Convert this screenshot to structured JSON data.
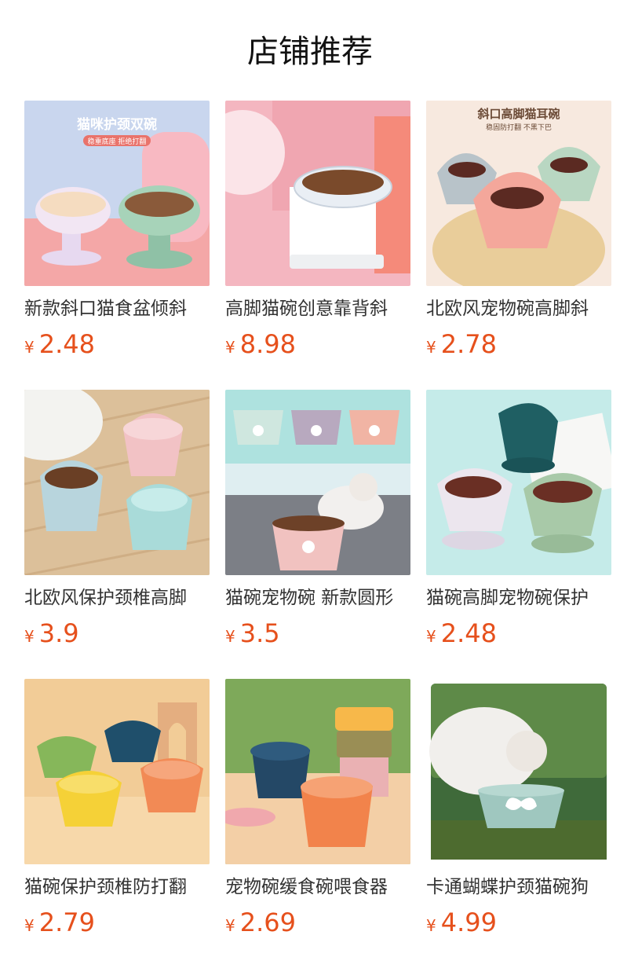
{
  "section": {
    "title": "店铺推荐"
  },
  "products": [
    {
      "name": "新款斜口猫食盆倾斜",
      "currency": "¥",
      "price": "2.48",
      "banner_title": "猫咪护颈双碗",
      "banner_sub": "稳重底座 拒绝打翻"
    },
    {
      "name": "高脚猫碗创意靠背斜",
      "currency": "¥",
      "price": "8.98"
    },
    {
      "name": "北欧风宠物碗高脚斜",
      "currency": "¥",
      "price": "2.78",
      "banner_title": "斜口高脚猫耳碗",
      "banner_sub": "稳固防打翻  不黑下巴"
    },
    {
      "name": "北欧风保护颈椎高脚",
      "currency": "¥",
      "price": "3.9"
    },
    {
      "name": "猫碗宠物碗 新款圆形",
      "currency": "¥",
      "price": "3.5"
    },
    {
      "name": "猫碗高脚宠物碗保护",
      "currency": "¥",
      "price": "2.48"
    },
    {
      "name": "猫碗保护颈椎防打翻",
      "currency": "¥",
      "price": "2.79"
    },
    {
      "name": "宠物碗缓食碗喂食器",
      "currency": "¥",
      "price": "2.69"
    },
    {
      "name": "卡通蝴蝶护颈猫碗狗",
      "currency": "¥",
      "price": "4.99"
    }
  ],
  "colors": {
    "price": "#e6501c",
    "title": "#111111",
    "name": "#333333"
  }
}
